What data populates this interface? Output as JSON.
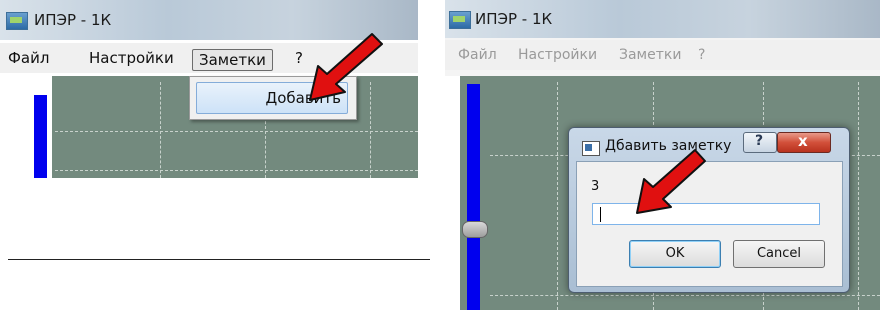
{
  "left_shot": {
    "window_title": "ИПЭР - 1К",
    "menu": [
      "Файл",
      "Настройки",
      "Заметки",
      "?"
    ],
    "active_menu": "Заметки",
    "dropdown_items": [
      "Добавить"
    ]
  },
  "right_shot": {
    "window_title": "ИПЭР - 1К",
    "menu": [
      "Файл",
      "Настройки",
      "Заметки",
      "?"
    ],
    "dialog": {
      "title": "Дбавить заметку",
      "help_label": "?",
      "close_label": "x",
      "field_label": "3",
      "input_value": "",
      "ok_label": "OK",
      "cancel_label": "Cancel"
    }
  },
  "colors": {
    "plot_background": "#738a7e",
    "level_bar": "#0000ee",
    "pointer_arrow": "#e01010"
  },
  "icons": [
    "app-icon",
    "red-pointer-arrow-icon",
    "dialog-icon"
  ]
}
